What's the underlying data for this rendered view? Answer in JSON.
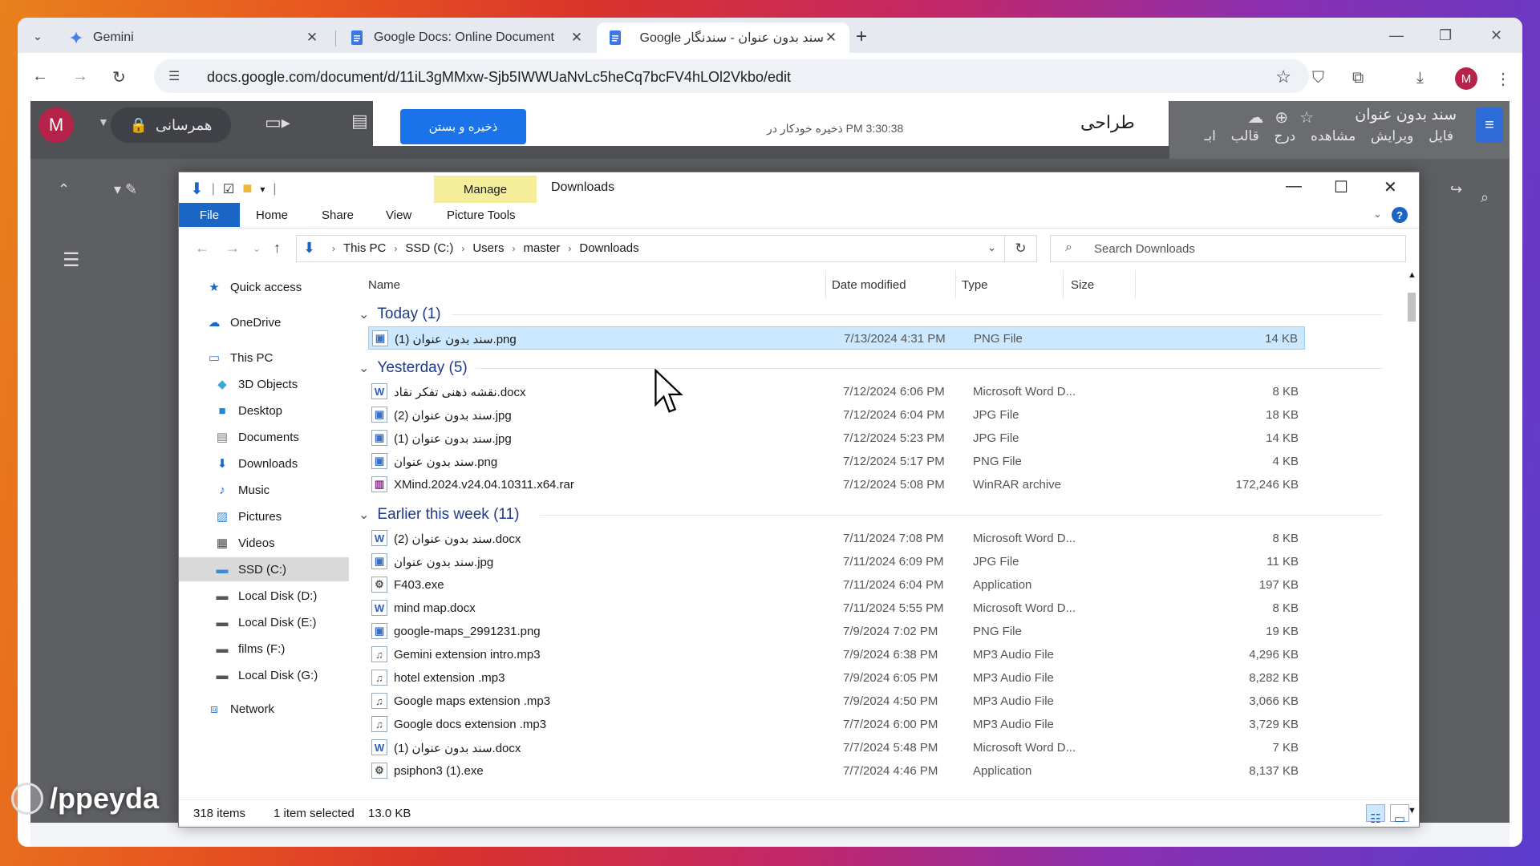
{
  "browser": {
    "tabs": [
      {
        "title": "Gemini",
        "icon": "gemini-icon"
      },
      {
        "title": "Google Docs: Online Document",
        "icon": "docs-icon"
      },
      {
        "title": "سند بدون عنوان - سندنگار Google",
        "icon": "docs-icon"
      }
    ],
    "new_tab": "+",
    "url": "docs.google.com/document/d/11iL3gMMxw-Sjb5IWWUaNvLc5heCq7bcFV4hLOl2Vkbo/edit",
    "profile_initial": "M"
  },
  "docs": {
    "profile_initial": "M",
    "share_label": "همرسانی",
    "save_button": "ذخیره و بستن",
    "autosave": "ذخیره خودکار در PM 3:30:38",
    "doc_title": "طراحی",
    "header_title": "سند بدون عنوان",
    "menu": "فایل ویرایش مشاهده درج قالب ابـ"
  },
  "explorer": {
    "manage": "Manage",
    "folder_title": "Downloads",
    "ribbon": {
      "file": "File",
      "home": "Home",
      "share": "Share",
      "view": "View",
      "picture_tools": "Picture Tools"
    },
    "breadcrumb": [
      "This PC",
      "SSD (C:)",
      "Users",
      "master",
      "Downloads"
    ],
    "search_placeholder": "Search Downloads",
    "nav": [
      {
        "label": "Quick access",
        "icon": "star-icon"
      },
      {
        "label": "OneDrive",
        "icon": "cloud-icon"
      },
      {
        "label": "This PC",
        "icon": "computer-icon"
      },
      {
        "label": "3D Objects",
        "icon": "cube-icon"
      },
      {
        "label": "Desktop",
        "icon": "desktop-icon"
      },
      {
        "label": "Documents",
        "icon": "document-icon"
      },
      {
        "label": "Downloads",
        "icon": "download-icon"
      },
      {
        "label": "Music",
        "icon": "music-icon"
      },
      {
        "label": "Pictures",
        "icon": "picture-icon"
      },
      {
        "label": "Videos",
        "icon": "video-icon"
      },
      {
        "label": "SSD (C:)",
        "icon": "drive-icon"
      },
      {
        "label": "Local Disk (D:)",
        "icon": "drive-icon"
      },
      {
        "label": "Local Disk (E:)",
        "icon": "drive-icon"
      },
      {
        "label": "films (F:)",
        "icon": "drive-icon"
      },
      {
        "label": "Local Disk (G:)",
        "icon": "drive-icon"
      },
      {
        "label": "Network",
        "icon": "network-icon"
      }
    ],
    "columns": {
      "name": "Name",
      "date": "Date modified",
      "type": "Type",
      "size": "Size"
    },
    "groups": [
      {
        "label": "Today (1)",
        "files": [
          {
            "name": "سند بدون عنوان (1).png",
            "date": "7/13/2024 4:31 PM",
            "type": "PNG File",
            "size": "14 KB",
            "icon": "image-file-icon"
          }
        ]
      },
      {
        "label": "Yesterday (5)",
        "files": [
          {
            "name": "نقشه ذهنی تفکر نقاد.docx",
            "date": "7/12/2024 6:06 PM",
            "type": "Microsoft Word D...",
            "size": "8 KB",
            "icon": "word-file-icon"
          },
          {
            "name": "سند بدون عنوان (2).jpg",
            "date": "7/12/2024 6:04 PM",
            "type": "JPG File",
            "size": "18 KB",
            "icon": "image-file-icon"
          },
          {
            "name": "سند بدون عنوان (1).jpg",
            "date": "7/12/2024 5:23 PM",
            "type": "JPG File",
            "size": "14 KB",
            "icon": "image-file-icon"
          },
          {
            "name": "سند بدون عنوان.png",
            "date": "7/12/2024 5:17 PM",
            "type": "PNG File",
            "size": "4 KB",
            "icon": "image-file-icon"
          },
          {
            "name": "XMind.2024.v24.04.10311.x64.rar",
            "date": "7/12/2024 5:08 PM",
            "type": "WinRAR archive",
            "size": "172,246 KB",
            "icon": "rar-file-icon"
          }
        ]
      },
      {
        "label": "Earlier this week (11)",
        "files": [
          {
            "name": "سند بدون عنوان (2).docx",
            "date": "7/11/2024 7:08 PM",
            "type": "Microsoft Word D...",
            "size": "8 KB",
            "icon": "word-file-icon"
          },
          {
            "name": "سند بدون عنوان.jpg",
            "date": "7/11/2024 6:09 PM",
            "type": "JPG File",
            "size": "11 KB",
            "icon": "image-file-icon"
          },
          {
            "name": "F403.exe",
            "date": "7/11/2024 6:04 PM",
            "type": "Application",
            "size": "197 KB",
            "icon": "exe-file-icon"
          },
          {
            "name": "mind map.docx",
            "date": "7/11/2024 5:55 PM",
            "type": "Microsoft Word D...",
            "size": "8 KB",
            "icon": "word-file-icon"
          },
          {
            "name": "google-maps_2991231.png",
            "date": "7/9/2024 7:02 PM",
            "type": "PNG File",
            "size": "19 KB",
            "icon": "image-file-icon"
          },
          {
            "name": "Gemini extension intro.mp3",
            "date": "7/9/2024 6:38 PM",
            "type": "MP3 Audio File",
            "size": "4,296 KB",
            "icon": "audio-file-icon"
          },
          {
            "name": "hotel extension .mp3",
            "date": "7/9/2024 6:05 PM",
            "type": "MP3 Audio File",
            "size": "8,282 KB",
            "icon": "audio-file-icon"
          },
          {
            "name": "Google maps extension .mp3",
            "date": "7/9/2024 4:50 PM",
            "type": "MP3 Audio File",
            "size": "3,066 KB",
            "icon": "audio-file-icon"
          },
          {
            "name": "Google docs extension .mp3",
            "date": "7/7/2024 6:00 PM",
            "type": "MP3 Audio File",
            "size": "3,729 KB",
            "icon": "audio-file-icon"
          },
          {
            "name": "سند بدون عنوان (1).docx",
            "date": "7/7/2024 5:48 PM",
            "type": "Microsoft Word D...",
            "size": "7 KB",
            "icon": "word-file-icon"
          },
          {
            "name": "psiphon3 (1).exe",
            "date": "7/7/2024 4:46 PM",
            "type": "Application",
            "size": "8,137 KB",
            "icon": "exe-file-icon"
          }
        ]
      }
    ],
    "status": {
      "count": "318 items",
      "selected": "1 item selected",
      "size": "13.0 KB"
    }
  },
  "watermark": "/ppeyda"
}
